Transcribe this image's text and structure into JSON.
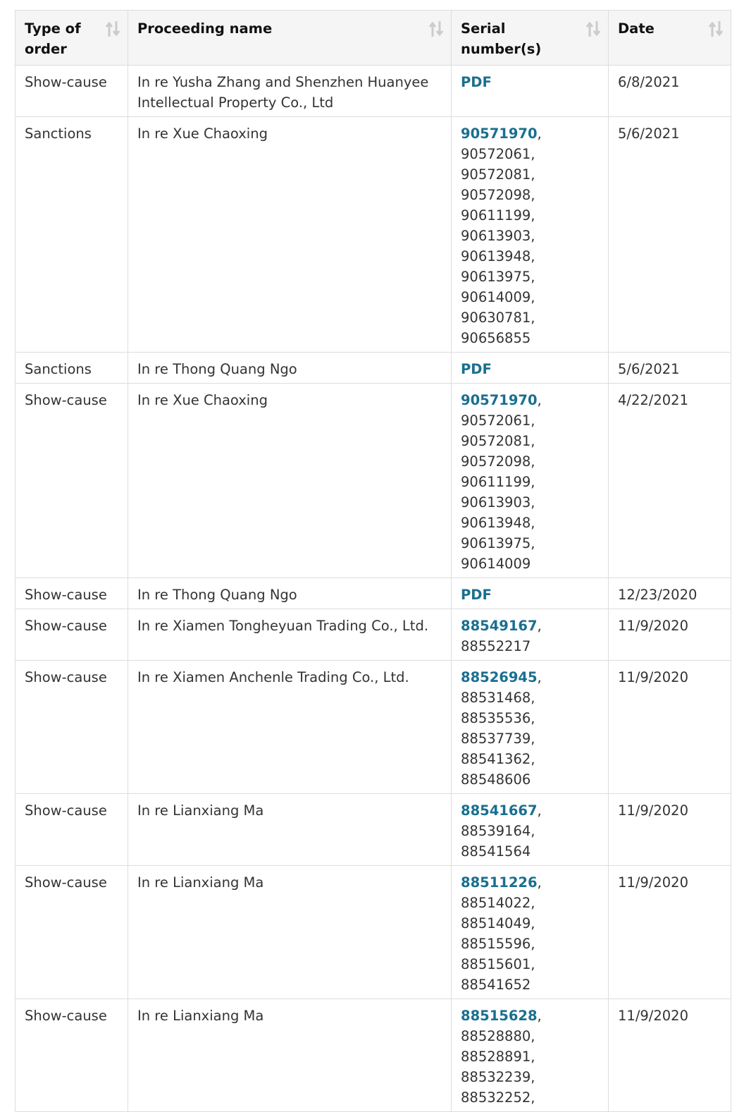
{
  "table": {
    "headers": [
      {
        "label": "Type of order",
        "sort_icon": "sort-arrows-icon"
      },
      {
        "label": "Proceeding name",
        "sort_icon": "sort-arrows-icon"
      },
      {
        "label": "Serial number(s)",
        "sort_icon": "sort-arrows-icon"
      },
      {
        "label": "Date",
        "sort_icon": "sort-arrows-icon"
      }
    ],
    "rows": [
      {
        "type": "Show-cause",
        "name": "In re Yusha Zhang and Shenzhen Huanyee Intellectual Property Co., Ltd",
        "link": "PDF",
        "rest": "",
        "date": "6/8/2021"
      },
      {
        "type": "Sanctions",
        "name": "In re Xue Chaoxing",
        "link": "90571970",
        "rest": ", 90572061, 90572081, 90572098, 90611199, 90613903, 90613948, 90613975, 90614009, 90630781, 90656855",
        "date": "5/6/2021"
      },
      {
        "type": "Sanctions",
        "name": "In re Thong Quang Ngo",
        "link": "PDF",
        "rest": "",
        "date": "5/6/2021"
      },
      {
        "type": "Show-cause",
        "name": "In re Xue Chaoxing",
        "link": "90571970",
        "rest": ", 90572061, 90572081, 90572098, 90611199, 90613903, 90613948, 90613975, 90614009",
        "date": "4/22/2021"
      },
      {
        "type": "Show-cause",
        "name": "In re Thong Quang Ngo",
        "link": "PDF",
        "rest": "",
        "date": "12/23/2020"
      },
      {
        "type": "Show-cause",
        "name": "In re Xiamen Tongheyuan Trading Co., Ltd.",
        "link": "88549167",
        "rest": ", 88552217",
        "date": "11/9/2020"
      },
      {
        "type": "Show-cause",
        "name": "In re Xiamen Anchenle Trading Co., Ltd.",
        "link": "88526945",
        "rest": ", 88531468, 88535536, 88537739, 88541362, 88548606",
        "date": "11/9/2020"
      },
      {
        "type": "Show-cause",
        "name": "In re Lianxiang Ma",
        "link": "88541667",
        "rest": ", 88539164, 88541564",
        "date": "11/9/2020"
      },
      {
        "type": "Show-cause",
        "name": "In re Lianxiang Ma",
        "link": "88511226",
        "rest": ", 88514022, 88514049, 88515596, 88515601, 88541652",
        "date": "11/9/2020"
      },
      {
        "type": "Show-cause",
        "name": "In re Lianxiang Ma",
        "link": "88515628",
        "rest": ", 88528880, 88528891, 88532239, 88532252,",
        "date": "11/9/2020"
      }
    ]
  },
  "colors": {
    "link": "#1a6f8f",
    "header_bg": "#f5f5f5",
    "border": "#dddddd",
    "sort_icon": "#cccccc"
  }
}
